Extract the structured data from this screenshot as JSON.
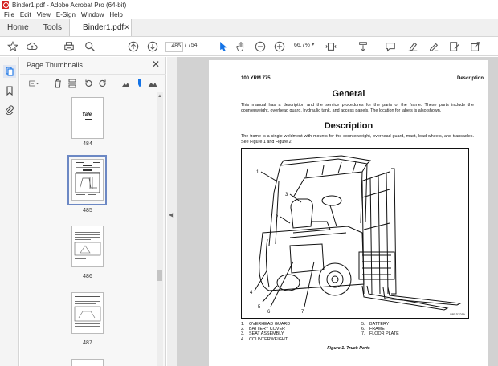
{
  "window": {
    "title": "Binder1.pdf - Adobe Acrobat Pro (64-bit)"
  },
  "menu": [
    "File",
    "Edit",
    "View",
    "E-Sign",
    "Window",
    "Help"
  ],
  "tabs": {
    "home": "Home",
    "tools": "Tools",
    "document": "Binder1.pdf"
  },
  "toolbar": {
    "page_current": "485",
    "page_total": "/ 754",
    "zoom": "66.7%"
  },
  "panel": {
    "title": "Page Thumbnails",
    "thumbnails": [
      {
        "label": "484",
        "logo": "Yale"
      },
      {
        "label": "485"
      },
      {
        "label": "486"
      },
      {
        "label": "487"
      }
    ],
    "selected_page": "485"
  },
  "document": {
    "header_left": "100 YRM 775",
    "header_right": "Description",
    "heading_general": "General",
    "para_general": "This manual has a description and the service procedures for the parts of the frame. These parts include the counterweight, overhead guard, hydraulic tank, and access panels. The location for labels is also shown.",
    "heading_description": "Description",
    "para_description": "The frame is a single weldment with mounts for the counterweight, overhead guard, mast, load wheels, and transaxles. See Figure 1 and Figure 2.",
    "figure_code": "Y8F-DX01A",
    "callouts": [
      "1",
      "2",
      "3",
      "4",
      "5",
      "6",
      "7"
    ],
    "legend_left": [
      {
        "num": "1.",
        "text": "OVERHEAD GUARD"
      },
      {
        "num": "2.",
        "text": "BATTERY COVER"
      },
      {
        "num": "3.",
        "text": "SEAT ASSEMBLY"
      },
      {
        "num": "4.",
        "text": "COUNTERWEIGHT"
      }
    ],
    "legend_right": [
      {
        "num": "5.",
        "text": "BATTERY"
      },
      {
        "num": "6.",
        "text": "FRAME"
      },
      {
        "num": "7.",
        "text": "FLOOR PLATE"
      }
    ],
    "figure_caption": "Figure 1.  Truck Parts"
  },
  "colors": {
    "accent": "#1473e6",
    "selection": "#6c88c4",
    "acrobat_red": "#d4201f"
  },
  "icons": {
    "toolbar": [
      "bookmark-star-icon",
      "upload-icon",
      "print-icon",
      "search-icon",
      "page-up-icon",
      "page-down-icon",
      "select-arrow-icon",
      "hand-icon",
      "zoom-out-icon",
      "zoom-in-icon",
      "page-fit-icon",
      "scroll-mode-icon",
      "comment-icon",
      "highlight-icon",
      "sign-icon",
      "edit-pdf-icon",
      "share-icon"
    ],
    "nav": [
      "page-thumbnails-icon",
      "bookmarks-icon",
      "attachments-icon"
    ],
    "panel_tools": [
      "options-icon",
      "delete-icon",
      "insert-icon",
      "undo-icon",
      "redo-icon",
      "small-thumb-icon",
      "marker-icon",
      "large-thumb-icon"
    ]
  }
}
